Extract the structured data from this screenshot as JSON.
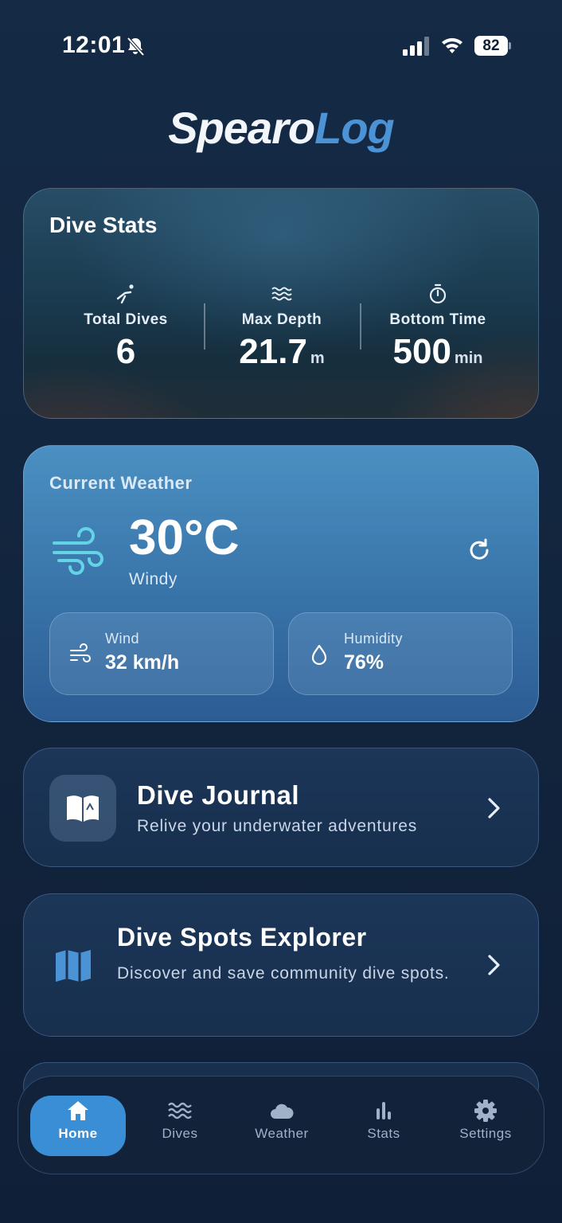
{
  "status_bar": {
    "time": "12:01",
    "battery": "82",
    "icons": [
      "bell-slash-icon",
      "signal-icon",
      "wifi-icon",
      "battery-icon"
    ]
  },
  "logo": {
    "part1": "Spearo",
    "part2": "Log"
  },
  "dive_stats": {
    "title": "Dive Stats",
    "items": [
      {
        "icon": "dive-icon",
        "label": "Total Dives",
        "value": "6",
        "unit": ""
      },
      {
        "icon": "waves-icon",
        "label": "Max Depth",
        "value": "21.7",
        "unit": "m"
      },
      {
        "icon": "stopwatch-icon",
        "label": "Bottom Time",
        "value": "500",
        "unit": "min"
      }
    ]
  },
  "weather": {
    "title": "Current Weather",
    "temperature": "30°C",
    "condition": "Windy",
    "icon": "wind-icon",
    "wind": {
      "label": "Wind",
      "value": "32 km/h",
      "icon": "wind-icon"
    },
    "humidity": {
      "label": "Humidity",
      "value": "76%",
      "icon": "droplet-icon"
    },
    "accent_color": "#63d3e6"
  },
  "journal": {
    "title": "Dive Journal",
    "subtitle": "Relive your underwater adventures",
    "icon": "book-icon"
  },
  "spots": {
    "title": "Dive Spots Explorer",
    "subtitle": "Discover and save community dive spots.",
    "icon": "map-icon"
  },
  "tabs": [
    {
      "label": "Home",
      "icon": "home-icon",
      "active": true
    },
    {
      "label": "Dives",
      "icon": "waves-icon",
      "active": false
    },
    {
      "label": "Weather",
      "icon": "cloud-icon",
      "active": false
    },
    {
      "label": "Stats",
      "icon": "bar-chart-icon",
      "active": false
    },
    {
      "label": "Settings",
      "icon": "gear-icon",
      "active": false
    }
  ],
  "colors": {
    "background": "#13263f",
    "card": "#1a3355",
    "weather_card": "#3f7fb5",
    "active_tab": "#3a8ed6",
    "map_icon": "#4c93d6"
  }
}
